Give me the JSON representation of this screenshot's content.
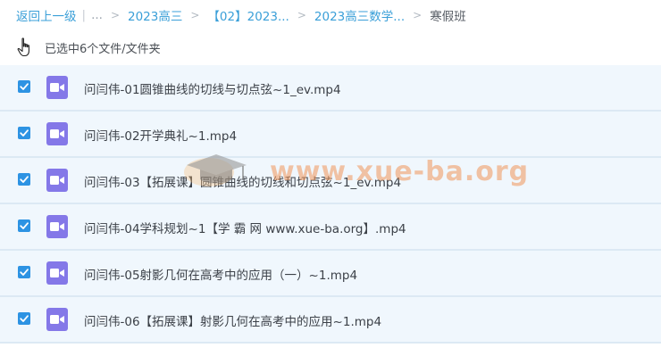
{
  "breadcrumb": {
    "back": "返回上一级",
    "ellipsis": "...",
    "items": [
      "2023高三",
      "【02】2023...",
      "2023高三数学...",
      "寒假班"
    ]
  },
  "selection": {
    "text": "已选中6个文件/文件夹"
  },
  "files": [
    {
      "name": "问闫伟-01圆锥曲线的切线与切点弦~1_ev.mp4",
      "checked": true
    },
    {
      "name": "问闫伟-02开学典礼~1.mp4",
      "checked": true
    },
    {
      "name": "问闫伟-03【拓展课】圆锥曲线的切线和切点弦~1_ev.mp4",
      "checked": true
    },
    {
      "name": "问闫伟-04学科规划~1【学 霸 网 www.xue-ba.org】.mp4",
      "checked": true
    },
    {
      "name": "问闫伟-05射影几何在高考中的应用（一）~1.mp4",
      "checked": true
    },
    {
      "name": "问闫伟-06【拓展课】射影几何在高考中的应用~1.mp4",
      "checked": true
    }
  ],
  "watermark": {
    "text": "www.xue-ba.org"
  },
  "colors": {
    "link": "#3a9fd8",
    "row_background": "#f0f7fd",
    "checkbox": "#2d93e3",
    "video_icon": "#8478e8"
  },
  "icons": {
    "cursor": "hand-pointer-icon",
    "file": "video-file-icon",
    "check": "checkmark-icon"
  }
}
